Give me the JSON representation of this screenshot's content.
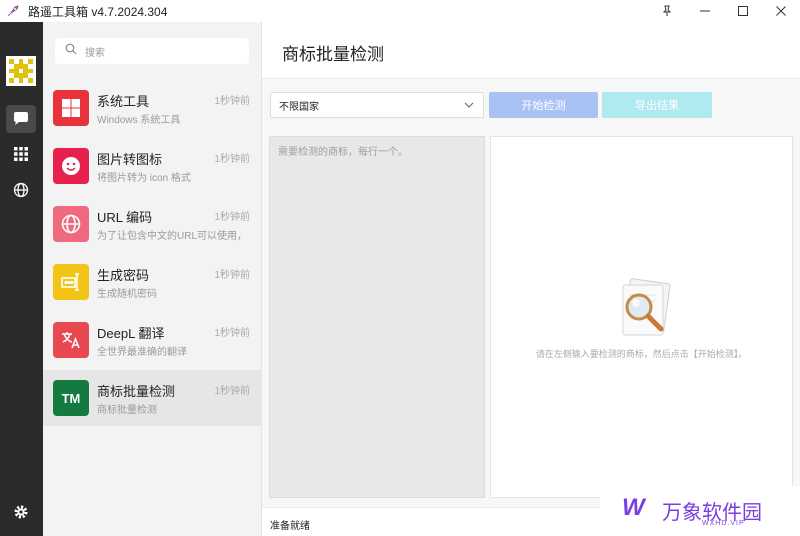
{
  "window": {
    "title": "路遥工具箱 v4.7.2024.304",
    "app_icon": "rocket-icon",
    "controls": [
      "pin-icon",
      "minimize-icon",
      "maximize-icon",
      "close-icon"
    ]
  },
  "rail": {
    "items": [
      {
        "icon": "chat-icon",
        "active": true
      },
      {
        "icon": "apps-grid-icon",
        "active": false
      },
      {
        "icon": "globe-icon",
        "active": false
      }
    ],
    "bottom_icon": "gear-icon"
  },
  "search": {
    "placeholder": "搜索",
    "icon": "search-icon"
  },
  "tools": [
    {
      "name": "系统工具",
      "desc": "Windows 系统工具",
      "time": "1秒钟前",
      "icon": "windows-icon",
      "color": "#e8323c"
    },
    {
      "name": "图片转图标",
      "desc": "将图片转为 icon 格式",
      "time": "1秒钟前",
      "icon": "smiley-icon",
      "color": "#e8204e"
    },
    {
      "name": "URL 编码",
      "desc": "为了让包含中文的URL可以使用，",
      "time": "1秒钟前",
      "icon": "globe-icon",
      "color": "#f06a7f"
    },
    {
      "name": "生成密码",
      "desc": "生成随机密码",
      "time": "1秒钟前",
      "icon": "password-icon",
      "color": "#f2c417"
    },
    {
      "name": "DeepL 翻译",
      "desc": "全世界最准确的翻译",
      "time": "1秒钟前",
      "icon": "translate-icon",
      "color": "#e8484f"
    },
    {
      "name": "商标批量检测",
      "desc": "商标批量检测",
      "time": "1秒钟前",
      "icon": "tm-icon",
      "icon_text": "TM",
      "color": "#157a3f",
      "selected": true
    }
  ],
  "main": {
    "title": "商标批量检测",
    "country_select": "不限国家",
    "start_button": "开始检测",
    "export_button": "导出结果",
    "input_placeholder": "需要检测的商标，每行一个。",
    "empty_hint": "请在左侧输入要检测的商标，然后点击【开始检测】。",
    "status": "准备就绪"
  },
  "watermark": {
    "brand": "万象软件园",
    "sub": "WXHD.VIP",
    "mark": "W"
  }
}
